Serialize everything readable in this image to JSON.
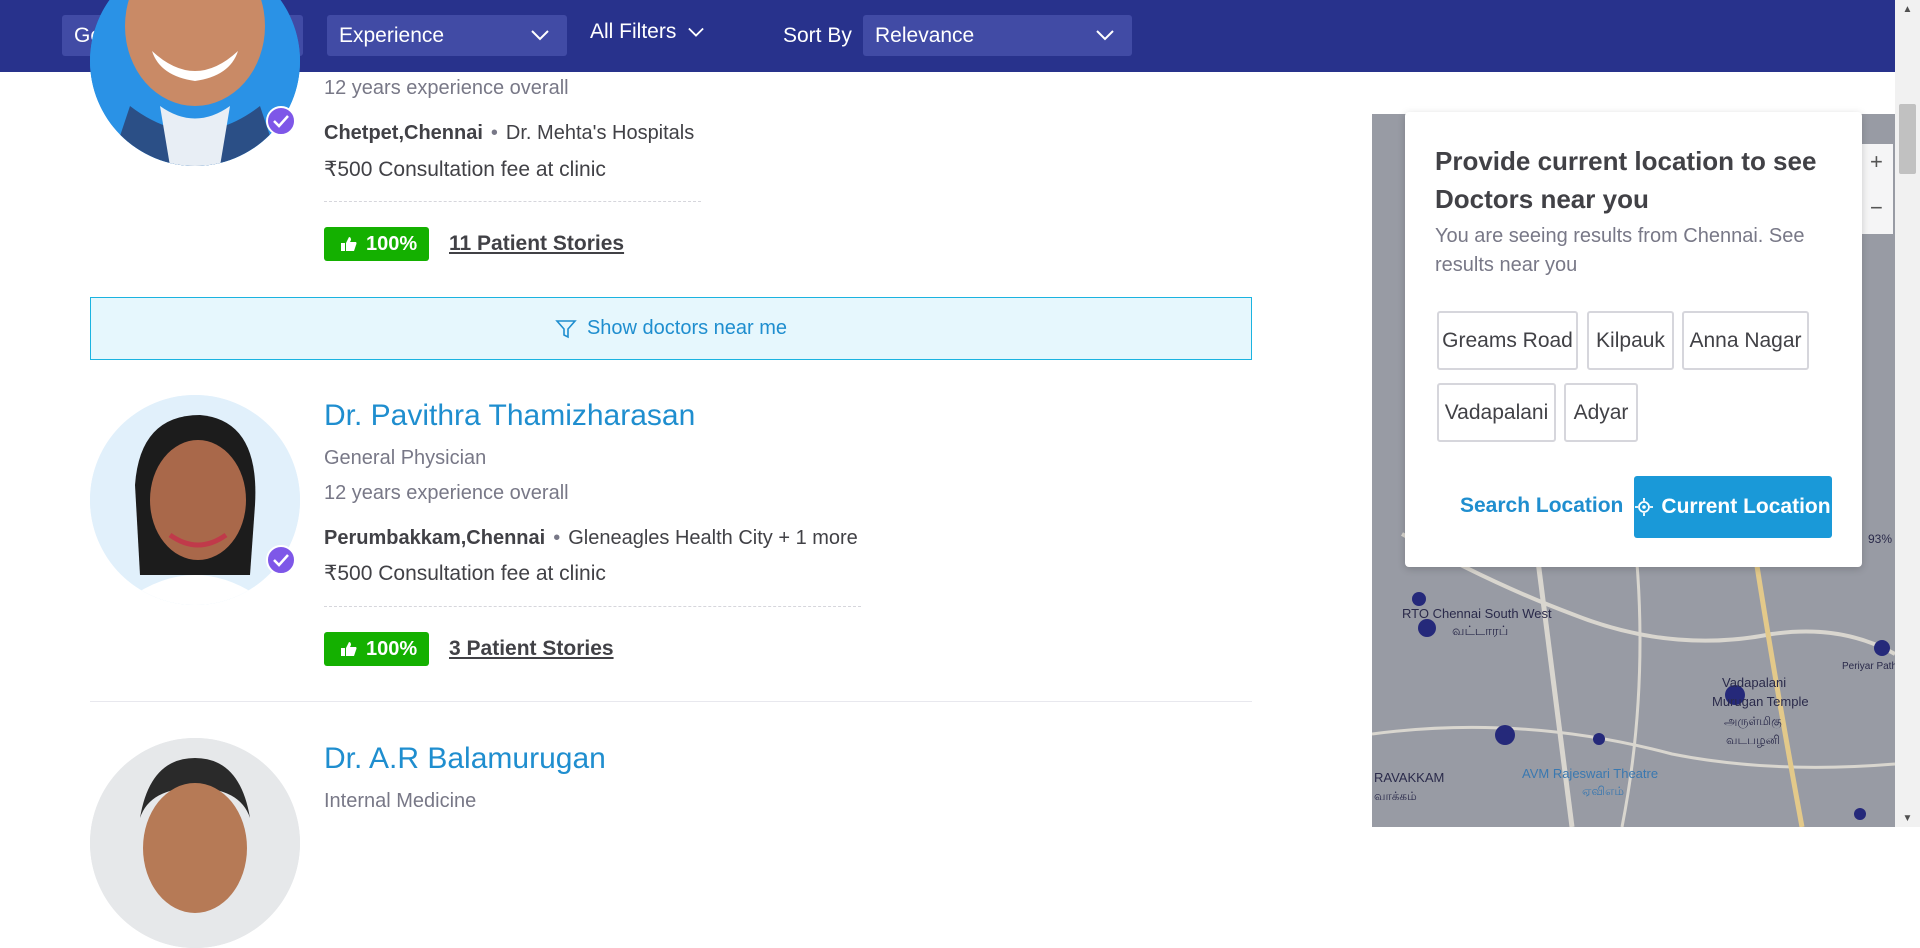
{
  "filters": {
    "gender": "Gender",
    "experience": "Experience",
    "all_filters": "All Filters",
    "sort_by_label": "Sort By",
    "sort_by_value": "Relevance"
  },
  "doctors": [
    {
      "name": "",
      "experience": "12 years experience overall",
      "locality": "Chetpet,Chennai",
      "clinic": "Dr. Mehta's Hospitals",
      "fee": "₹500 Consultation fee at clinic",
      "recommendation": "100%",
      "stories": "11 Patient Stories"
    },
    {
      "name": "Dr. Pavithra Thamizharasan",
      "specialty": "General Physician",
      "experience": "12 years experience overall",
      "locality": "Perumbakkam,Chennai",
      "clinic": "Gleneagles Health City + 1 more",
      "fee": "₹500 Consultation fee at clinic",
      "recommendation": "100%",
      "stories": "3 Patient Stories"
    },
    {
      "name": "Dr. A.R Balamurugan",
      "specialty": "Internal Medicine"
    }
  ],
  "near_me_banner": "Show doctors near me",
  "location_popup": {
    "title": "Provide current location to see Doctors near you",
    "subtitle": "You are seeing results from Chennai. See results near you",
    "chips": [
      "Greams Road",
      "Kilpauk",
      "Anna Nagar",
      "Vadapalani",
      "Adyar"
    ],
    "search_label": "Search Location",
    "current_label": "Current Location"
  },
  "map": {
    "labels": [
      "RTO Chennai South West",
      "வட்டாரப்",
      "Vadapalani",
      "Murugan Temple",
      "அருள்மிகு",
      "வடபழனி",
      "RAVAKKAM",
      "வாக்கம்",
      "AVM Rajeswari Theatre",
      "ஏவிஎம்",
      "Periyar Pathai",
      "93%"
    ],
    "zoom_in": "+",
    "zoom_out": "−"
  },
  "colors": {
    "topbar": "#28328c",
    "dropdown": "#414ba5",
    "link_blue": "#1f8ecf",
    "badge_green": "#14b000",
    "verified_purple": "#7e57e8",
    "button_blue": "#1a99d8"
  }
}
